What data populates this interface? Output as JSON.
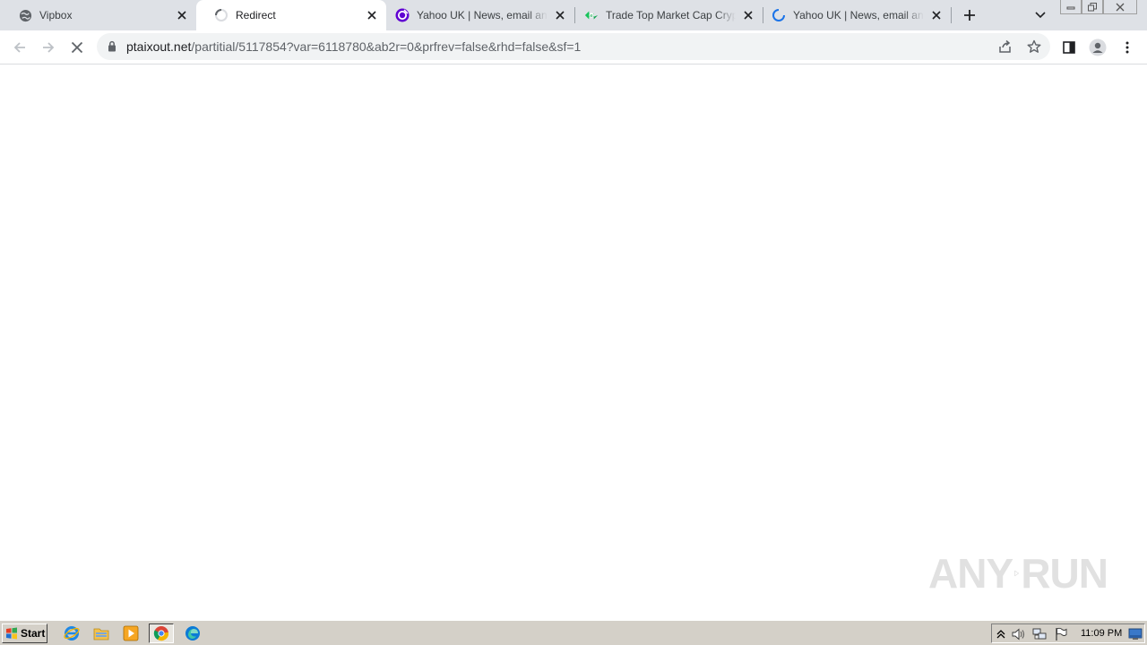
{
  "browser": {
    "tabs": [
      {
        "title": "Vipbox",
        "favicon": "globe-icon",
        "active": false
      },
      {
        "title": "Redirect",
        "favicon": "loading-spinner-icon",
        "active": true
      },
      {
        "title": "Yahoo UK | News, email and search",
        "favicon": "yahoo-icon",
        "active": false
      },
      {
        "title": "Trade Top Market Cap CryptoCurrencies",
        "favicon": "crypto-exchange-icon",
        "active": false
      },
      {
        "title": "Yahoo UK | News, email and search",
        "favicon": "loading-spinner-icon",
        "active": false
      }
    ],
    "address": {
      "host": "ptaixout.net",
      "path": "/partitial/5117854?var=6118780&ab2r=0&prfrev=false&rhd=false&sf=1"
    },
    "accent_color": "#1a73e8"
  },
  "watermark": {
    "left": "ANY",
    "right": "RUN"
  },
  "taskbar": {
    "start_label": "Start",
    "clock": "11:09 PM"
  }
}
